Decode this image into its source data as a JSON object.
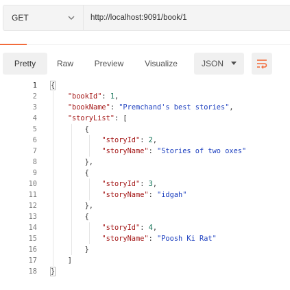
{
  "request": {
    "method": "GET",
    "url": "http://localhost:9091/book/1"
  },
  "toolbar": {
    "pretty": "Pretty",
    "raw": "Raw",
    "preview": "Preview",
    "visualize": "Visualize",
    "format": "JSON"
  },
  "lines": [
    "1",
    "2",
    "3",
    "4",
    "5",
    "6",
    "7",
    "8",
    "9",
    "10",
    "11",
    "12",
    "13",
    "14",
    "15",
    "16",
    "17",
    "18"
  ],
  "body": {
    "open": "{",
    "bookId_key": "\"bookId\"",
    "bookId_val": "1",
    "bookName_key": "\"bookName\"",
    "bookName_val": "\"Premchand's best stories\"",
    "storyList_key": "\"storyList\"",
    "stories": [
      {
        "id_key": "\"storyId\"",
        "id_val": "2",
        "name_key": "\"storyName\"",
        "name_val": "\"Stories of two oxes\""
      },
      {
        "id_key": "\"storyId\"",
        "id_val": "3",
        "name_key": "\"storyName\"",
        "name_val": "\"idgah\""
      },
      {
        "id_key": "\"storyId\"",
        "id_val": "4",
        "name_key": "\"storyName\"",
        "name_val": "\"Poosh Ki Rat\""
      }
    ],
    "close": "}"
  },
  "colors": {
    "accent": "#f26b3a",
    "key": "#a31515",
    "string": "#1c3fbf",
    "number": "#0a6e51"
  },
  "icons": {
    "method_dropdown": "chevron-down-icon",
    "format_dropdown": "caret-down-icon",
    "wrap": "wrap-lines-icon"
  }
}
